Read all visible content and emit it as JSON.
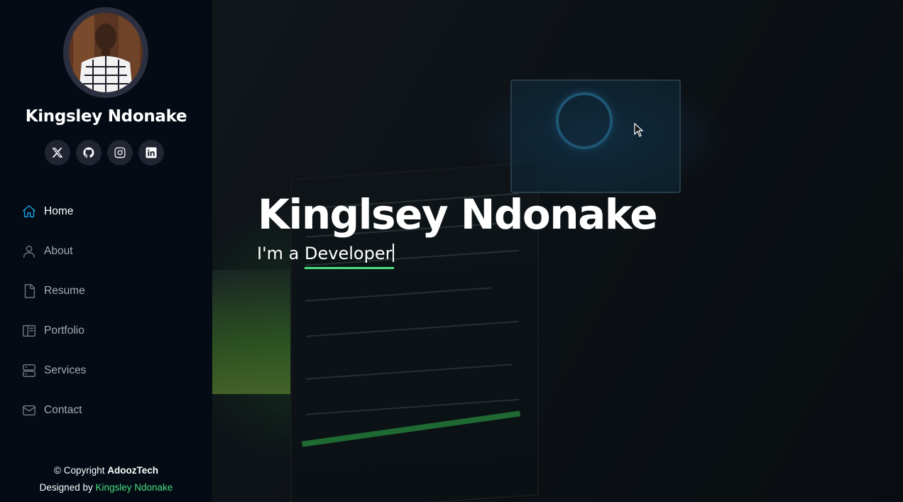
{
  "sidebar": {
    "profile_name": "Kingsley Ndonake",
    "social": [
      {
        "name": "x-twitter-icon"
      },
      {
        "name": "github-icon"
      },
      {
        "name": "instagram-icon"
      },
      {
        "name": "linkedin-icon"
      }
    ],
    "nav": [
      {
        "label": "Home",
        "icon": "home-icon",
        "active": true
      },
      {
        "label": "About",
        "icon": "user-icon",
        "active": false
      },
      {
        "label": "Resume",
        "icon": "file-icon",
        "active": false
      },
      {
        "label": "Portfolio",
        "icon": "book-icon",
        "active": false
      },
      {
        "label": "Services",
        "icon": "server-icon",
        "active": false
      },
      {
        "label": "Contact",
        "icon": "envelope-icon",
        "active": false
      }
    ],
    "footer": {
      "copyright_prefix": "© Copyright",
      "brand": "AdoozTech",
      "designed_prefix": "Designed by",
      "designer": "Kingsley Ndonake"
    }
  },
  "hero": {
    "title": "Kinglsey Ndonake",
    "sub_prefix": "I'm a ",
    "sub_typed": "Developer"
  },
  "colors": {
    "sidebar_bg": "#040b14",
    "accent_green": "#4ade80",
    "active_icon": "#149ddd"
  }
}
